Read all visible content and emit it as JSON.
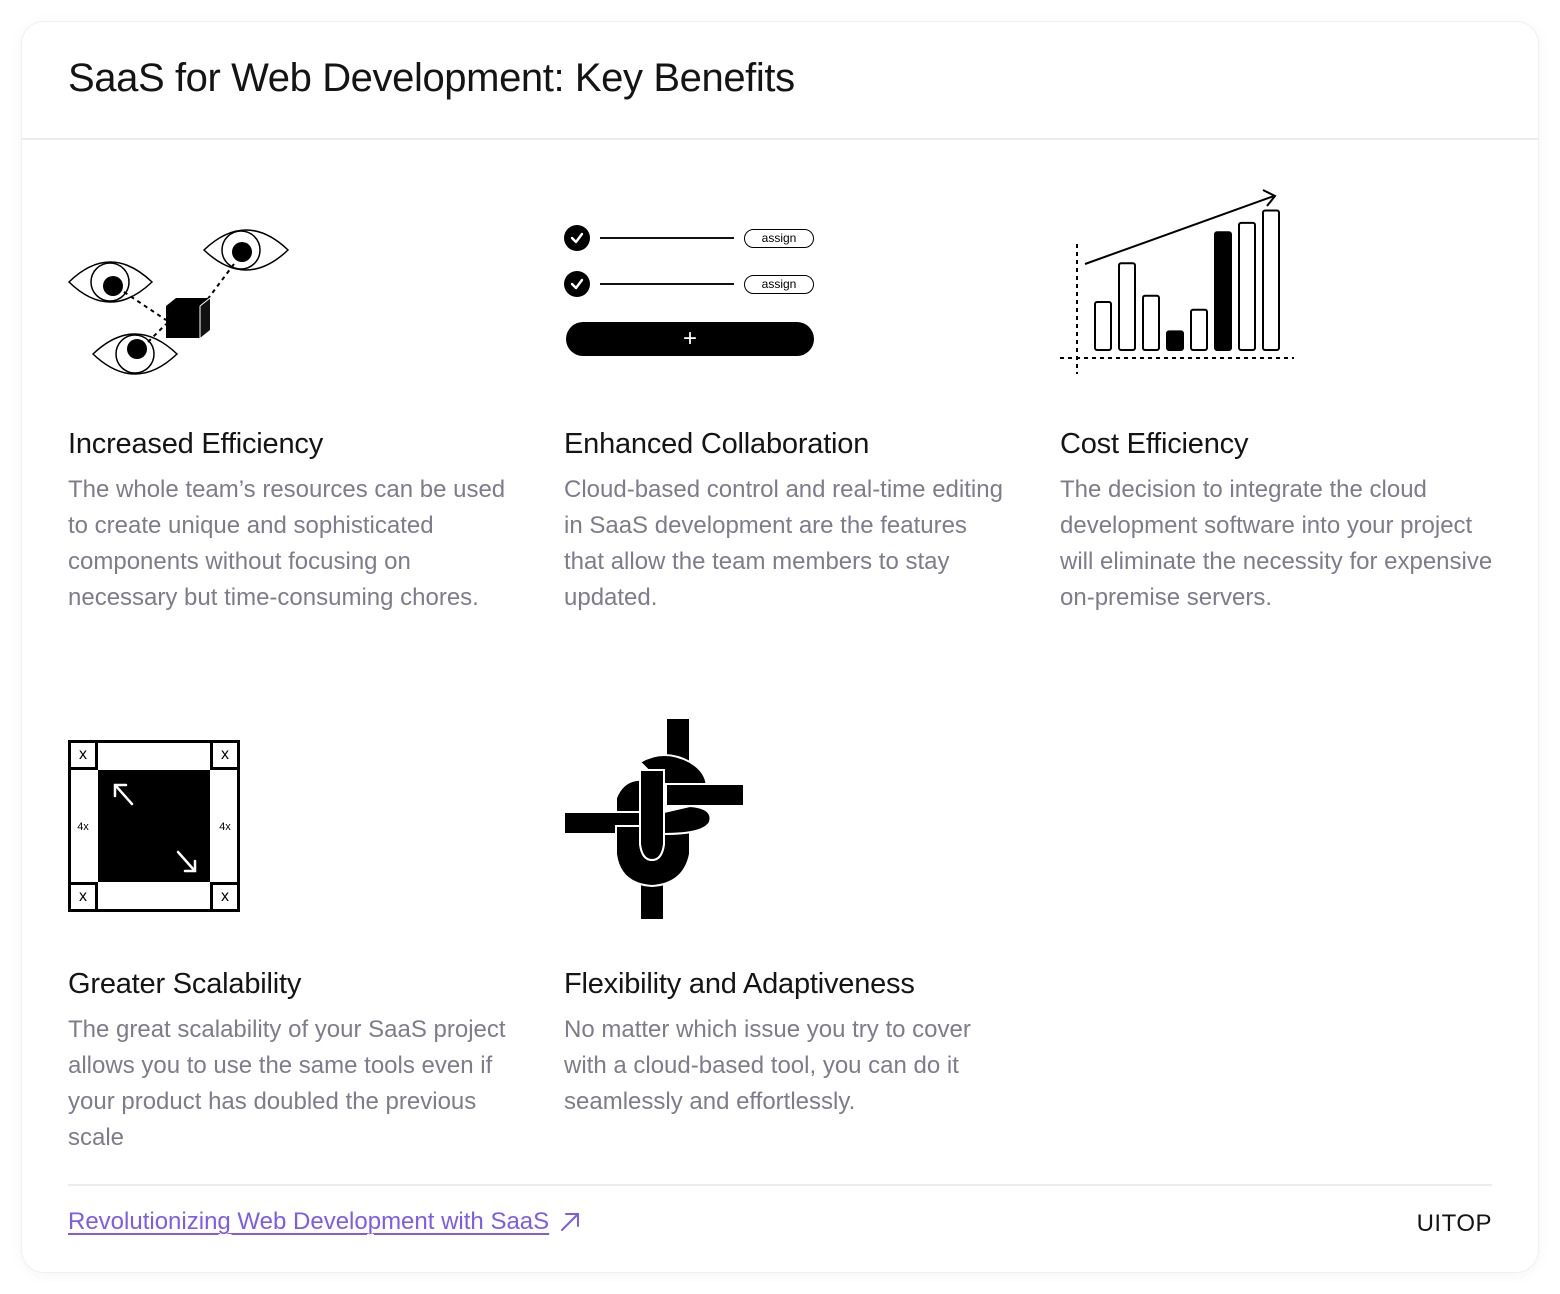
{
  "header": {
    "title": "SaaS for Web Development: Key Benefits"
  },
  "items": [
    {
      "title": "Increased Efficiency",
      "description": "The whole team’s resources can be used to create unique and sophisticated components without focusing on necessary but time-consuming chores.",
      "illustration": "eyes-watching-cube"
    },
    {
      "title": "Enhanced Collaboration",
      "description": "Cloud-based control and real-time editing in SaaS development are the features that allow the team members to stay updated.",
      "illustration": "task-assign-list",
      "tasks": [
        {
          "checked": true,
          "button_label": "assign"
        },
        {
          "checked": true,
          "button_label": "assign"
        }
      ],
      "add_label": "+"
    },
    {
      "title": "Cost Efficiency",
      "description": "The decision to integrate the cloud development software into your project will eliminate the necessity for expensive on-premise servers.",
      "illustration": "growth-bar-chart",
      "bars": [
        {
          "value": 0.31,
          "filled": false
        },
        {
          "value": 0.56,
          "filled": false
        },
        {
          "value": 0.35,
          "filled": false
        },
        {
          "value": 0.12,
          "filled": false,
          "dark": true
        },
        {
          "value": 0.26,
          "filled": false
        },
        {
          "value": 0.76,
          "filled": true
        },
        {
          "value": 0.82,
          "filled": false
        },
        {
          "value": 0.9,
          "filled": false
        }
      ]
    },
    {
      "title": "Greater Scalability",
      "description": "The great scalability of your SaaS project allows you to use the same tools even if your product has doubled the previous scale",
      "illustration": "scale-frame",
      "corner_label": "x",
      "side_label": "4x"
    },
    {
      "title": "Flexibility and Adaptiveness",
      "description": "No matter which issue you try to cover with a cloud-based tool, you can do it seamlessly and effortlessly.",
      "illustration": "interwoven-knot"
    }
  ],
  "footer": {
    "link_label": "Revolutionizing Web Development with SaaS",
    "link_icon": "arrow-up-right-icon",
    "brand": "UITOP",
    "accent_color": "#7b5cf0"
  }
}
